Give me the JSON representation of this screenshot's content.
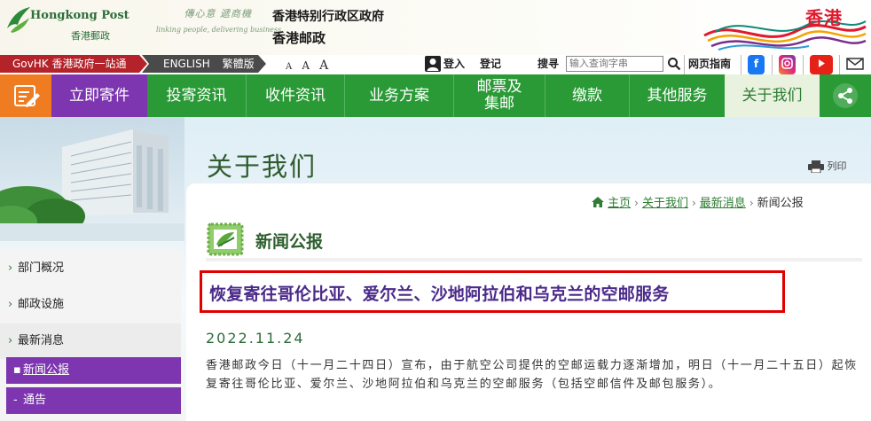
{
  "header": {
    "logo_en": "Hongkong Post",
    "logo_zh": "香港郵政",
    "slogan_zh": "傳心意 遞商機",
    "slogan_en": "linking people, delivering business",
    "gov_line1": "香港特别行政区政府",
    "gov_line2": "香港邮政",
    "brand_hk": "香港"
  },
  "utility": {
    "govhk": "GovHK 香港政府一站通",
    "lang_english": "ENGLISH",
    "lang_trad": "繁體版",
    "font_sizes": [
      "A",
      "A",
      "A"
    ],
    "login": "登入",
    "register": "登记",
    "search_label": "搜寻",
    "search_placeholder": "输入查询字串",
    "sitemap": "网页指南"
  },
  "nav": {
    "items": [
      "立即寄件",
      "投寄资讯",
      "收件资讯",
      "业务方案",
      "邮票及集邮",
      "缴款",
      "其他服务",
      "关于我们"
    ],
    "stamps_line1": "邮票及",
    "stamps_line2": "集邮"
  },
  "page": {
    "title": "关于我们",
    "print": "列印"
  },
  "breadcrumb": {
    "home": "主页",
    "about": "关于我们",
    "latest": "最新消息",
    "current": "新闻公报"
  },
  "sidebar": {
    "items": [
      "部门概况",
      "邮政设施",
      "最新消息"
    ],
    "sub_items": [
      "新闻公报",
      "通告"
    ]
  },
  "article": {
    "section": "新闻公报",
    "headline": "恢复寄往哥伦比亚、爱尔兰、沙地阿拉伯和乌克兰的空邮服务",
    "date": "2022.11.24",
    "body": "香港邮政今日（十一月二十四日）宣布，由于航空公司提供的空邮运载力逐渐增加，明日（十一月二十五日）起恢复寄往哥伦比亚、爱尔兰、沙地阿拉伯和乌克兰的空邮服务（包括空邮信件及邮包服务）。"
  },
  "colors": {
    "nav_green": "#2a9a36",
    "nav_purple": "#7d35b0",
    "home_orange": "#f07c22",
    "govhk_red": "#b4232a",
    "highlight_red": "#e10000",
    "headline_purple": "#4b2a8a"
  },
  "icons": [
    "bird-logo-icon",
    "user-icon",
    "search-icon",
    "facebook-icon",
    "instagram-icon",
    "youtube-icon",
    "mail-icon",
    "share-icon",
    "print-icon",
    "home-icon",
    "stamp-icon"
  ]
}
